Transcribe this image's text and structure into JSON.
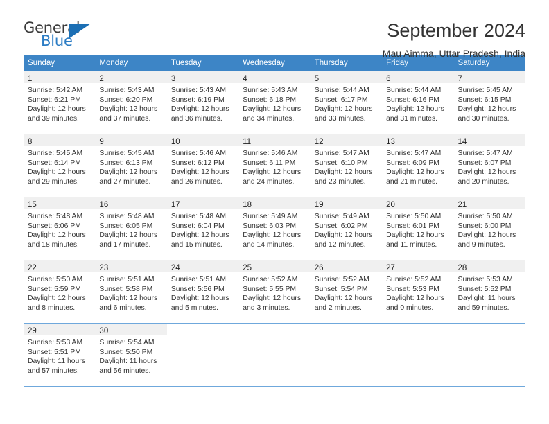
{
  "brand": {
    "name_part1": "General",
    "name_part2": "Blue",
    "triangle_icon": "blue-triangle-logo-icon",
    "accent_color": "#2b7cc4"
  },
  "header": {
    "title": "September 2024",
    "subtitle": "Mau Aimma, Uttar Pradesh, India"
  },
  "theme": {
    "header_bg": "#3d85c6",
    "row_divider": "#6fa8dc",
    "day_band_bg": "#f0f0f0",
    "text": "#333333"
  },
  "weekdays": [
    "Sunday",
    "Monday",
    "Tuesday",
    "Wednesday",
    "Thursday",
    "Friday",
    "Saturday"
  ],
  "weeks": [
    [
      {
        "day": "1",
        "sunrise": "Sunrise: 5:42 AM",
        "sunset": "Sunset: 6:21 PM",
        "daylight1": "Daylight: 12 hours",
        "daylight2": "and 39 minutes."
      },
      {
        "day": "2",
        "sunrise": "Sunrise: 5:43 AM",
        "sunset": "Sunset: 6:20 PM",
        "daylight1": "Daylight: 12 hours",
        "daylight2": "and 37 minutes."
      },
      {
        "day": "3",
        "sunrise": "Sunrise: 5:43 AM",
        "sunset": "Sunset: 6:19 PM",
        "daylight1": "Daylight: 12 hours",
        "daylight2": "and 36 minutes."
      },
      {
        "day": "4",
        "sunrise": "Sunrise: 5:43 AM",
        "sunset": "Sunset: 6:18 PM",
        "daylight1": "Daylight: 12 hours",
        "daylight2": "and 34 minutes."
      },
      {
        "day": "5",
        "sunrise": "Sunrise: 5:44 AM",
        "sunset": "Sunset: 6:17 PM",
        "daylight1": "Daylight: 12 hours",
        "daylight2": "and 33 minutes."
      },
      {
        "day": "6",
        "sunrise": "Sunrise: 5:44 AM",
        "sunset": "Sunset: 6:16 PM",
        "daylight1": "Daylight: 12 hours",
        "daylight2": "and 31 minutes."
      },
      {
        "day": "7",
        "sunrise": "Sunrise: 5:45 AM",
        "sunset": "Sunset: 6:15 PM",
        "daylight1": "Daylight: 12 hours",
        "daylight2": "and 30 minutes."
      }
    ],
    [
      {
        "day": "8",
        "sunrise": "Sunrise: 5:45 AM",
        "sunset": "Sunset: 6:14 PM",
        "daylight1": "Daylight: 12 hours",
        "daylight2": "and 29 minutes."
      },
      {
        "day": "9",
        "sunrise": "Sunrise: 5:45 AM",
        "sunset": "Sunset: 6:13 PM",
        "daylight1": "Daylight: 12 hours",
        "daylight2": "and 27 minutes."
      },
      {
        "day": "10",
        "sunrise": "Sunrise: 5:46 AM",
        "sunset": "Sunset: 6:12 PM",
        "daylight1": "Daylight: 12 hours",
        "daylight2": "and 26 minutes."
      },
      {
        "day": "11",
        "sunrise": "Sunrise: 5:46 AM",
        "sunset": "Sunset: 6:11 PM",
        "daylight1": "Daylight: 12 hours",
        "daylight2": "and 24 minutes."
      },
      {
        "day": "12",
        "sunrise": "Sunrise: 5:47 AM",
        "sunset": "Sunset: 6:10 PM",
        "daylight1": "Daylight: 12 hours",
        "daylight2": "and 23 minutes."
      },
      {
        "day": "13",
        "sunrise": "Sunrise: 5:47 AM",
        "sunset": "Sunset: 6:09 PM",
        "daylight1": "Daylight: 12 hours",
        "daylight2": "and 21 minutes."
      },
      {
        "day": "14",
        "sunrise": "Sunrise: 5:47 AM",
        "sunset": "Sunset: 6:07 PM",
        "daylight1": "Daylight: 12 hours",
        "daylight2": "and 20 minutes."
      }
    ],
    [
      {
        "day": "15",
        "sunrise": "Sunrise: 5:48 AM",
        "sunset": "Sunset: 6:06 PM",
        "daylight1": "Daylight: 12 hours",
        "daylight2": "and 18 minutes."
      },
      {
        "day": "16",
        "sunrise": "Sunrise: 5:48 AM",
        "sunset": "Sunset: 6:05 PM",
        "daylight1": "Daylight: 12 hours",
        "daylight2": "and 17 minutes."
      },
      {
        "day": "17",
        "sunrise": "Sunrise: 5:48 AM",
        "sunset": "Sunset: 6:04 PM",
        "daylight1": "Daylight: 12 hours",
        "daylight2": "and 15 minutes."
      },
      {
        "day": "18",
        "sunrise": "Sunrise: 5:49 AM",
        "sunset": "Sunset: 6:03 PM",
        "daylight1": "Daylight: 12 hours",
        "daylight2": "and 14 minutes."
      },
      {
        "day": "19",
        "sunrise": "Sunrise: 5:49 AM",
        "sunset": "Sunset: 6:02 PM",
        "daylight1": "Daylight: 12 hours",
        "daylight2": "and 12 minutes."
      },
      {
        "day": "20",
        "sunrise": "Sunrise: 5:50 AM",
        "sunset": "Sunset: 6:01 PM",
        "daylight1": "Daylight: 12 hours",
        "daylight2": "and 11 minutes."
      },
      {
        "day": "21",
        "sunrise": "Sunrise: 5:50 AM",
        "sunset": "Sunset: 6:00 PM",
        "daylight1": "Daylight: 12 hours",
        "daylight2": "and 9 minutes."
      }
    ],
    [
      {
        "day": "22",
        "sunrise": "Sunrise: 5:50 AM",
        "sunset": "Sunset: 5:59 PM",
        "daylight1": "Daylight: 12 hours",
        "daylight2": "and 8 minutes."
      },
      {
        "day": "23",
        "sunrise": "Sunrise: 5:51 AM",
        "sunset": "Sunset: 5:58 PM",
        "daylight1": "Daylight: 12 hours",
        "daylight2": "and 6 minutes."
      },
      {
        "day": "24",
        "sunrise": "Sunrise: 5:51 AM",
        "sunset": "Sunset: 5:56 PM",
        "daylight1": "Daylight: 12 hours",
        "daylight2": "and 5 minutes."
      },
      {
        "day": "25",
        "sunrise": "Sunrise: 5:52 AM",
        "sunset": "Sunset: 5:55 PM",
        "daylight1": "Daylight: 12 hours",
        "daylight2": "and 3 minutes."
      },
      {
        "day": "26",
        "sunrise": "Sunrise: 5:52 AM",
        "sunset": "Sunset: 5:54 PM",
        "daylight1": "Daylight: 12 hours",
        "daylight2": "and 2 minutes."
      },
      {
        "day": "27",
        "sunrise": "Sunrise: 5:52 AM",
        "sunset": "Sunset: 5:53 PM",
        "daylight1": "Daylight: 12 hours",
        "daylight2": "and 0 minutes."
      },
      {
        "day": "28",
        "sunrise": "Sunrise: 5:53 AM",
        "sunset": "Sunset: 5:52 PM",
        "daylight1": "Daylight: 11 hours",
        "daylight2": "and 59 minutes."
      }
    ],
    [
      {
        "day": "29",
        "sunrise": "Sunrise: 5:53 AM",
        "sunset": "Sunset: 5:51 PM",
        "daylight1": "Daylight: 11 hours",
        "daylight2": "and 57 minutes."
      },
      {
        "day": "30",
        "sunrise": "Sunrise: 5:54 AM",
        "sunset": "Sunset: 5:50 PM",
        "daylight1": "Daylight: 11 hours",
        "daylight2": "and 56 minutes."
      },
      {
        "day": "",
        "sunrise": "",
        "sunset": "",
        "daylight1": "",
        "daylight2": ""
      },
      {
        "day": "",
        "sunrise": "",
        "sunset": "",
        "daylight1": "",
        "daylight2": ""
      },
      {
        "day": "",
        "sunrise": "",
        "sunset": "",
        "daylight1": "",
        "daylight2": ""
      },
      {
        "day": "",
        "sunrise": "",
        "sunset": "",
        "daylight1": "",
        "daylight2": ""
      },
      {
        "day": "",
        "sunrise": "",
        "sunset": "",
        "daylight1": "",
        "daylight2": ""
      }
    ]
  ]
}
